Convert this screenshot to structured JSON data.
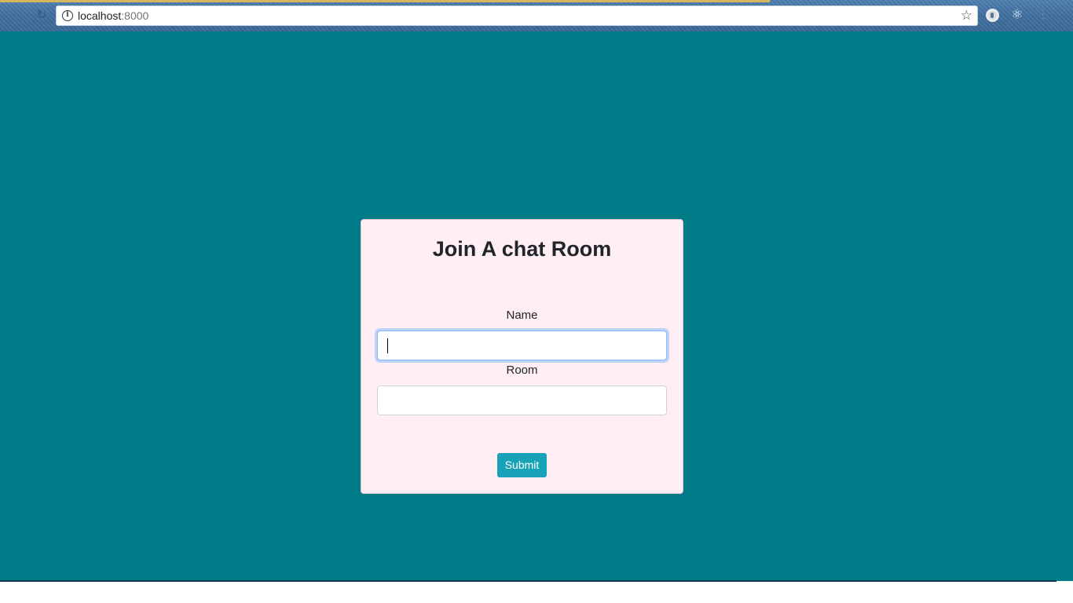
{
  "browser": {
    "url_host": "localhost",
    "url_port": ":8000",
    "icons": [
      "reload-icon",
      "info-icon",
      "star-icon",
      "extension-icon",
      "react-devtools-icon",
      "menu-icon"
    ]
  },
  "page": {
    "background_color": "#007c89",
    "card_color": "#ffeef3",
    "title": "Join A chat Room",
    "form": {
      "name_label": "Name",
      "name_value": "",
      "room_label": "Room",
      "room_value": "",
      "submit_label": "Submit",
      "submit_color": "#17a2b8"
    }
  }
}
